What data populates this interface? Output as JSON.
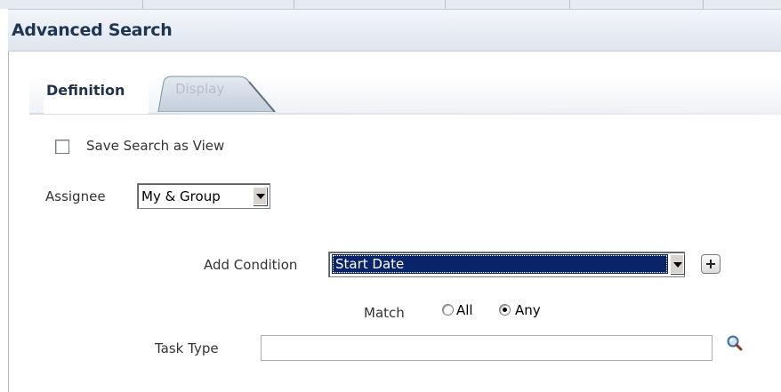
{
  "panel": {
    "title": "Advanced Search"
  },
  "tabs": [
    {
      "label": "Definition",
      "active": true
    },
    {
      "label": "Display",
      "active": false
    }
  ],
  "save_search": {
    "label": "Save Search as View",
    "checked": false
  },
  "assignee": {
    "label": "Assignee",
    "value": "My & Group"
  },
  "add_condition": {
    "label": "Add Condition",
    "value": "Start Date"
  },
  "match": {
    "label": "Match",
    "options": [
      {
        "label": "All",
        "selected": false
      },
      {
        "label": "Any",
        "selected": true
      }
    ]
  },
  "task_type": {
    "label": "Task Type",
    "value": ""
  },
  "icons": {
    "add": "plus-icon",
    "search": "magnifier-icon",
    "dropdown": "chevron-down-icon"
  },
  "colors": {
    "header_title": "#1f3552",
    "selection_bg": "#0a246a",
    "label_text": "#333333"
  }
}
